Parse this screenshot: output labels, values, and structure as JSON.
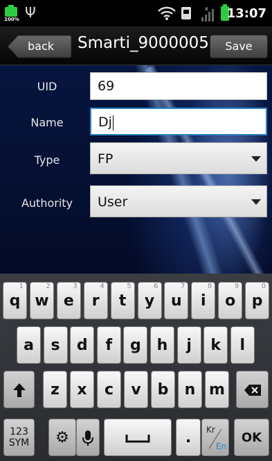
{
  "status_bar": {
    "battery_left_percent": "100%",
    "usb_icon": "usb-icon",
    "time": "13:07"
  },
  "title_bar": {
    "back_label": "back",
    "title": "Smarti_9000005",
    "save_label": "Save"
  },
  "form": {
    "uid": {
      "label": "UID",
      "value": "69"
    },
    "name": {
      "label": "Name",
      "value": "Dj"
    },
    "type": {
      "label": "Type",
      "value": "FP"
    },
    "authority": {
      "label": "Authority",
      "value": "User"
    }
  },
  "keyboard": {
    "row1": [
      {
        "k": "q",
        "n": "1"
      },
      {
        "k": "w",
        "n": "2"
      },
      {
        "k": "e",
        "n": "3"
      },
      {
        "k": "r",
        "n": "4"
      },
      {
        "k": "t",
        "n": "5"
      },
      {
        "k": "y",
        "n": "6"
      },
      {
        "k": "u",
        "n": "7"
      },
      {
        "k": "i",
        "n": "8"
      },
      {
        "k": "o",
        "n": "9"
      },
      {
        "k": "p",
        "n": "0"
      }
    ],
    "row2": [
      "a",
      "s",
      "d",
      "f",
      "g",
      "h",
      "j",
      "k",
      "l"
    ],
    "row3": [
      "z",
      "x",
      "c",
      "v",
      "b",
      "n",
      "m"
    ],
    "sym_line1": "123",
    "sym_line2": "SYM",
    "lang_top": "Kr",
    "lang_bottom": "En",
    "period": ".",
    "ok_label": "OK"
  },
  "colors": {
    "status_battery": "#2ecc40",
    "focus_border": "#2b88c9",
    "lang_en": "#2b88c9"
  }
}
